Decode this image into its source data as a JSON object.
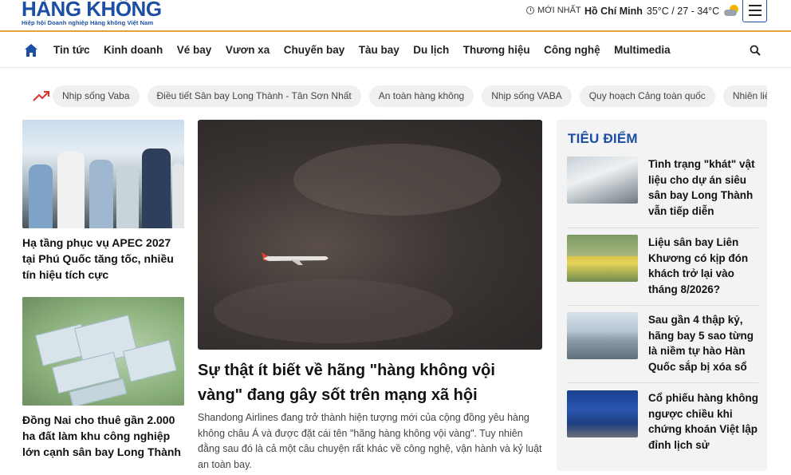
{
  "header": {
    "logo_title": "HÀNG KHÔNG",
    "logo_subtitle": "Hiệp hội Doanh nghiệp Hàng không Việt Nam",
    "latest_label": "MỚI NHẤT",
    "weather_city": "Hồ Chí Minh",
    "weather_temp": "35°C / 27 - 34°C",
    "weather_icon": "partly-cloudy-icon"
  },
  "nav": {
    "items": [
      "Tin tức",
      "Kinh doanh",
      "Vé bay",
      "Vươn xa",
      "Chuyến bay",
      "Tàu bay",
      "Du lịch",
      "Thương hiệu",
      "Công nghệ",
      "Multimedia"
    ]
  },
  "tags": [
    "Nhịp sống Vaba",
    "Điều tiết Sân bay Long Thành - Tân Sơn Nhất",
    "An toàn hàng không",
    "Nhịp sống VABA",
    "Quy hoạch Cảng toàn quốc",
    "Nhiên liệu hàng không"
  ],
  "left": [
    {
      "title": "Hạ tầng phục vụ APEC 2027 tại Phú Quốc tăng tốc, nhiều tín hiệu tích cực"
    },
    {
      "title": "Đồng Nai cho thuê gần 2.000 ha đất làm khu công nghiệp lớn cạnh sân bay Long Thành"
    }
  ],
  "feature": {
    "title": "Sự thật ít biết về hãng \"hàng không vội vàng\" đang gây sốt trên mạng xã hội",
    "description": "Shandong Airlines đang trở thành hiện tượng mới của cộng đồng yêu hàng không châu Á và được đặt cái tên \"hãng hàng không vội vàng\". Tuy nhiên đằng sau đó là cả một câu chuyện rất khác về công nghệ, vận hành và kỷ luật an toàn bay."
  },
  "focus": {
    "heading": "TIÊU ĐIỂM",
    "items": [
      {
        "title": "Tình trạng \"khát\" vật liệu cho dự án siêu sân bay Long Thành vẫn tiếp diễn"
      },
      {
        "title": "Liệu sân bay Liên Khương có kịp đón khách trở lại vào tháng 8/2026?"
      },
      {
        "title": "Sau gần 4 thập kỷ, hãng bay 5 sao từng là niềm tự hào Hàn Quốc sắp bị xóa sổ"
      },
      {
        "title": "Cổ phiếu hàng không ngược chiều khi chứng khoán Việt lập đỉnh lịch sử"
      }
    ]
  },
  "colors": {
    "brand": "#1c4ea3",
    "accent": "#e8a23a",
    "trend": "#d9342b"
  }
}
